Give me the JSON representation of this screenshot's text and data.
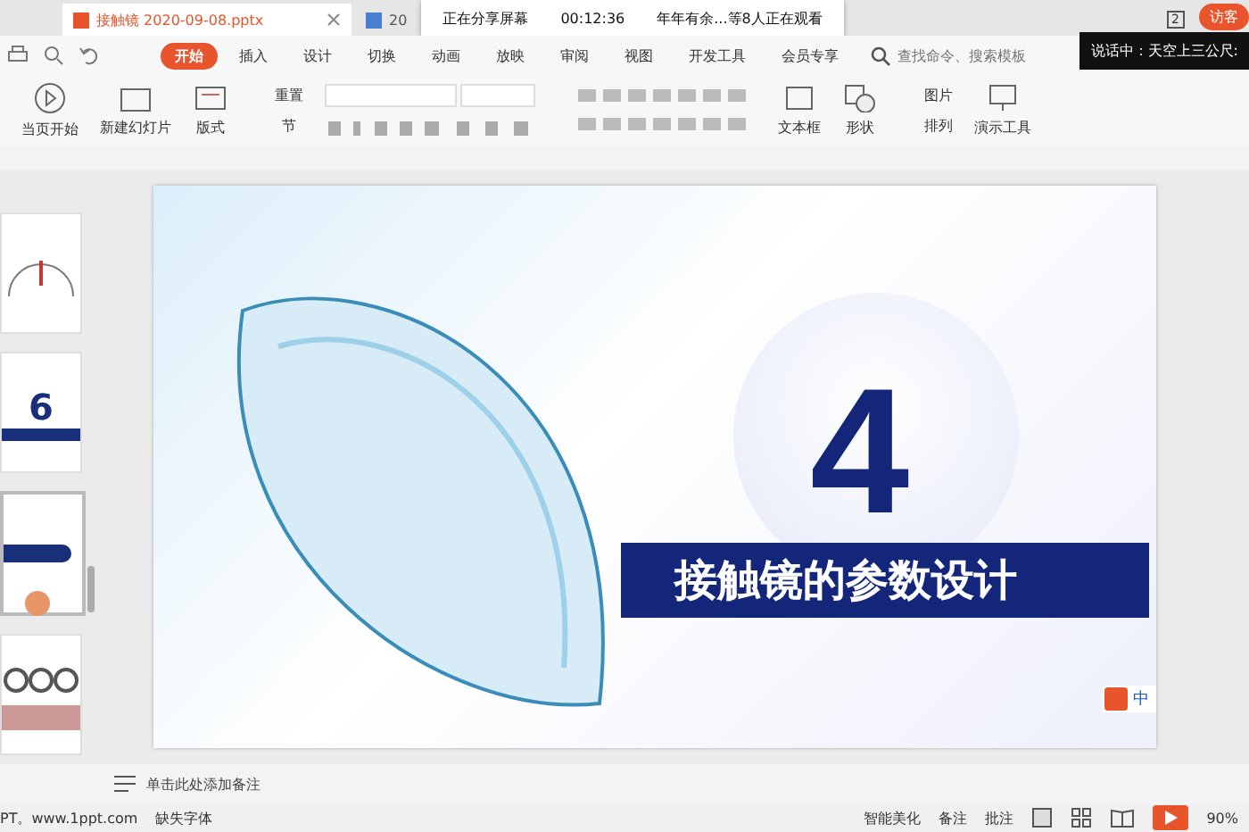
{
  "tabs": [
    {
      "label": "接触镜 2020-09-08.pptx",
      "selected": true
    },
    {
      "label": "20",
      "selected": false
    }
  ],
  "share_banner": {
    "status": "正在分享屏幕",
    "time": "00:12:36",
    "viewers": "年年有余...等8人正在观看"
  },
  "window_badge": "2",
  "user_button": "访客",
  "speaking_tooltip": "说话中：天空上三公尺:",
  "menu": [
    {
      "label": "开始",
      "selected": true
    },
    {
      "label": "插入",
      "selected": false
    },
    {
      "label": "设计",
      "selected": false
    },
    {
      "label": "切换",
      "selected": false
    },
    {
      "label": "动画",
      "selected": false
    },
    {
      "label": "放映",
      "selected": false
    },
    {
      "label": "审阅",
      "selected": false
    },
    {
      "label": "视图",
      "selected": false
    },
    {
      "label": "开发工具",
      "selected": false
    },
    {
      "label": "会员专享",
      "selected": false
    }
  ],
  "search": {
    "placeholder": "查找命令、搜索模板"
  },
  "ribbon": {
    "play_from_current": "当页开始",
    "new_slide": "新建幻灯片",
    "layout": "版式",
    "reset": "重置",
    "section": "节",
    "text_box": "文本框",
    "shape": "形状",
    "picture": "图片",
    "arrange": "排列",
    "presentation_tools": "演示工具"
  },
  "thumbnails": [
    {
      "kind": "diagram",
      "selected": false
    },
    {
      "kind": "number",
      "text": "6",
      "selected": false
    },
    {
      "kind": "banner",
      "selected": true
    },
    {
      "kind": "photos",
      "selected": false
    }
  ],
  "slide": {
    "number": "4",
    "title": "接触镜的参数设计"
  },
  "notes": {
    "placeholder": "单击此处添加备注"
  },
  "status_bar": {
    "source": "PT。www.1ppt.com",
    "missing_fonts": "缺失字体",
    "smart_beautify": "智能美化",
    "notes": "备注",
    "comments": "批注",
    "zoom": "90%"
  },
  "ime": "中"
}
